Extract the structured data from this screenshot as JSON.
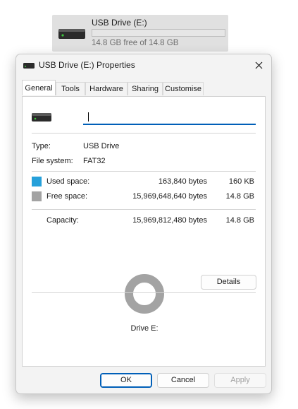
{
  "background_tile": {
    "name": "USB Drive (E:)",
    "free_text": "14.8 GB free of 14.8 GB",
    "used_fraction": 0.0
  },
  "dialog": {
    "title": "USB Drive (E:) Properties",
    "tabs": [
      {
        "label": "General",
        "active": true
      },
      {
        "label": "Tools",
        "active": false
      },
      {
        "label": "Hardware",
        "active": false
      },
      {
        "label": "Sharing",
        "active": false
      },
      {
        "label": "Customise",
        "active": false
      }
    ],
    "name_field_value": "",
    "type_label": "Type:",
    "type_value": "USB Drive",
    "fs_label": "File system:",
    "fs_value": "FAT32",
    "used": {
      "label": "Used space:",
      "bytes": "163,840 bytes",
      "size": "160 KB"
    },
    "free": {
      "label": "Free space:",
      "bytes": "15,969,648,640 bytes",
      "size": "14.8 GB"
    },
    "capacity": {
      "label": "Capacity:",
      "bytes": "15,969,812,480 bytes",
      "size": "14.8 GB"
    },
    "drive_label": "Drive E:",
    "details_button": "Details",
    "ok_button": "OK",
    "cancel_button": "Cancel",
    "apply_button": "Apply"
  },
  "colors": {
    "used_space": "#26a0da",
    "free_space": "#a3a3a3",
    "accent": "#005fb8"
  },
  "icons": [
    "drive-icon",
    "close-icon"
  ]
}
